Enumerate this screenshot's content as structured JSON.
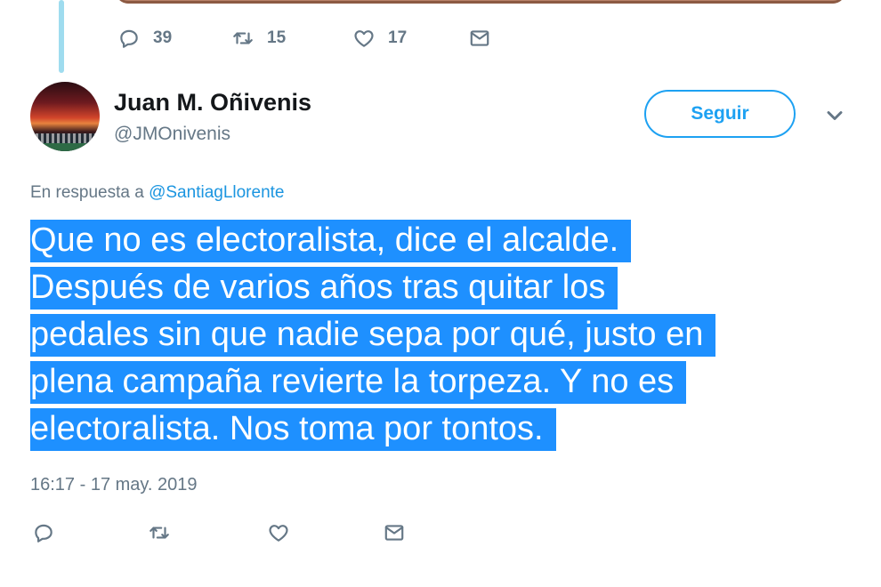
{
  "previous_tweet": {
    "replies": "39",
    "retweets": "15",
    "likes": "17"
  },
  "tweet": {
    "display_name": "Juan M. Oñivenis",
    "handle": "@JMOnivenis",
    "follow_label": "Seguir",
    "reply_prefix": "En respuesta a",
    "reply_mention": "@SantiagLlorente",
    "text_lines": [
      "Que no es electoralista, dice el alcalde.",
      "Después de varios años tras quitar los",
      "pedales sin que nadie sepa por qué, justo en",
      "plena campaña revierte la torpeza. Y no es",
      "electoralista. Nos toma por tontos."
    ],
    "timestamp": "16:17 - 17 may. 2019"
  },
  "icons": {
    "reply": "reply-icon",
    "retweet": "retweet-icon",
    "like": "heart-icon",
    "dm": "envelope-icon",
    "more": "chevron-down-icon"
  },
  "colors": {
    "accent": "#1da1f2",
    "muted": "#657786",
    "selection": "#1e90ff",
    "thread_line": "#9fdcef"
  }
}
